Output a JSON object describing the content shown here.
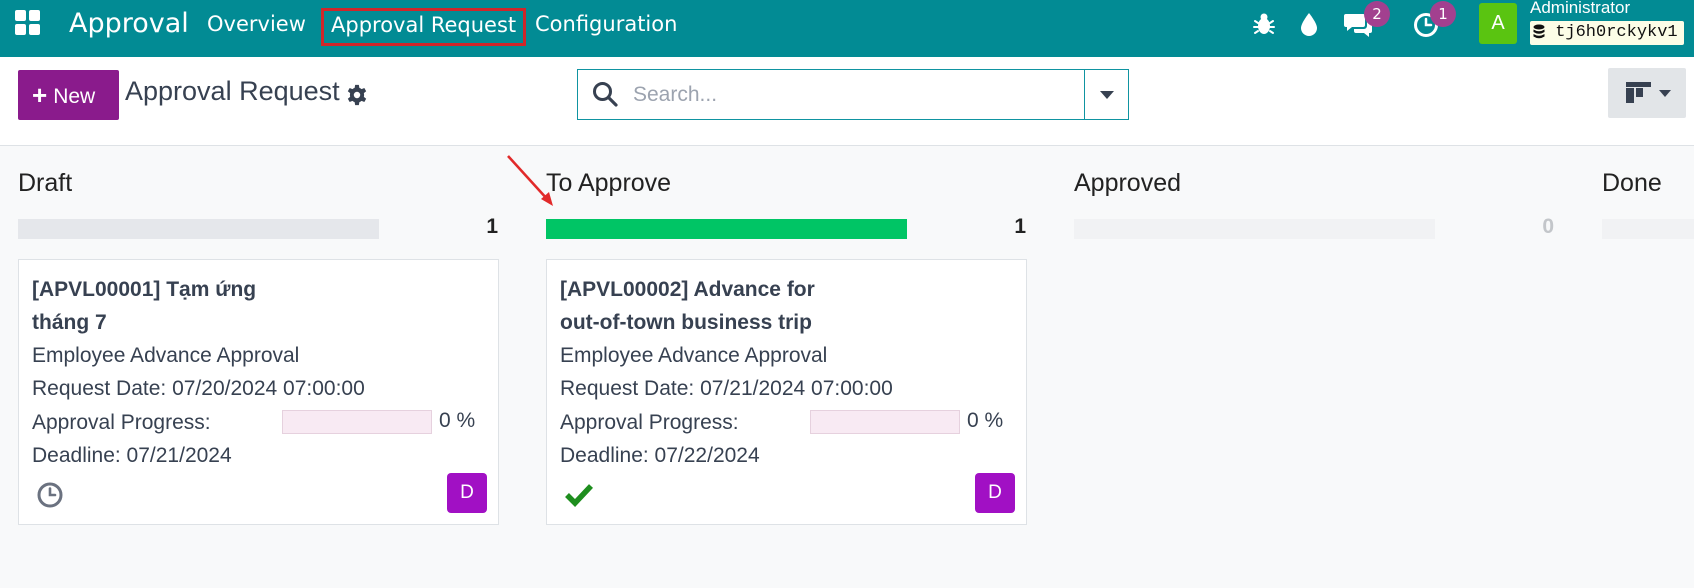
{
  "navbar": {
    "app_name": "Approval",
    "menu": [
      "Overview",
      "Approval Request",
      "Configuration"
    ],
    "message_count": "2",
    "activity_count": "1",
    "avatar_letter": "A",
    "user_name": "Administrator",
    "database": "tj6h0rckykv1"
  },
  "control_panel": {
    "new_label": "New",
    "title": "Approval Request",
    "search_placeholder": "Search..."
  },
  "kanban": {
    "columns": [
      {
        "title": "Draft",
        "count": "1",
        "progress": 0,
        "card": {
          "title_line1": "[APVL00001] Tạm ứng",
          "title_line2": "tháng 7",
          "category": "Employee Advance Approval",
          "request_date": "Request Date: 07/20/2024 07:00:00",
          "progress_label": "Approval Progress:",
          "progress_pct": "0 %",
          "deadline": "Deadline: 07/21/2024",
          "status_icon": "clock-icon",
          "avatar": "D"
        }
      },
      {
        "title": "To Approve",
        "count": "1",
        "progress": 1,
        "card": {
          "title_line1": "[APVL00002] Advance for",
          "title_line2": "out-of-town business trip",
          "category": "Employee Advance Approval",
          "request_date": "Request Date: 07/21/2024 07:00:00",
          "progress_label": "Approval Progress:",
          "progress_pct": "0 %",
          "deadline": "Deadline: 07/22/2024",
          "status_icon": "check-icon",
          "avatar": "D"
        }
      },
      {
        "title": "Approved",
        "count": "0",
        "progress": 0
      },
      {
        "title": "Done"
      }
    ]
  },
  "colors": {
    "navbar": "#028b94",
    "primary_button": "#8a1b8c",
    "progress_green": "#00c565",
    "card_avatar": "#a110c4",
    "highlight_red": "#d0262a"
  }
}
